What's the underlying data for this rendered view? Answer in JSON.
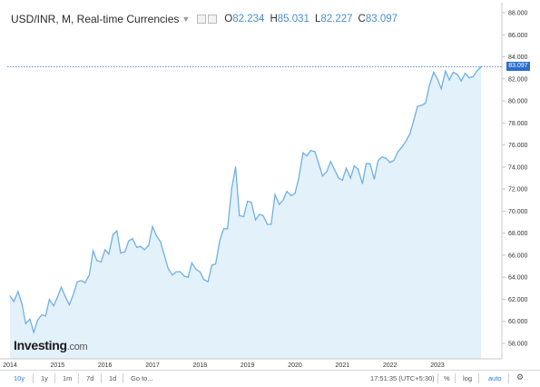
{
  "chart_data": {
    "type": "area",
    "title": "USD/INR, M, Real-time Currencies",
    "ohlc": {
      "open_label": "O",
      "open": "82.234",
      "high_label": "H",
      "high": "85.031",
      "low_label": "L",
      "low": "82.227",
      "close_label": "C",
      "close": "83.097"
    },
    "last_price_label": "83.097",
    "last_price": 83.097,
    "ylim": [
      57.0,
      88.5
    ],
    "xlim": [
      2014.0,
      2023.92
    ],
    "y_ticks": [
      "88.000",
      "86.000",
      "84.000",
      "82.000",
      "80.000",
      "78.000",
      "76.000",
      "74.000",
      "72.000",
      "70.000",
      "68.000",
      "66.000",
      "64.000",
      "62.000",
      "60.000",
      "58.000"
    ],
    "x_ticks": [
      "2014",
      "2015",
      "2016",
      "2017",
      "2018",
      "2019",
      "2020",
      "2021",
      "2022",
      "2023"
    ],
    "series": [
      {
        "color": "#6fb0e6",
        "fill": "#e3f1fb",
        "x": [
          2014.0,
          2014.08,
          2014.17,
          2014.25,
          2014.33,
          2014.42,
          2014.5,
          2014.58,
          2014.67,
          2014.75,
          2014.83,
          2014.92,
          2015.0,
          2015.08,
          2015.17,
          2015.25,
          2015.33,
          2015.42,
          2015.5,
          2015.58,
          2015.67,
          2015.75,
          2015.83,
          2015.92,
          2016.0,
          2016.08,
          2016.17,
          2016.25,
          2016.33,
          2016.42,
          2016.5,
          2016.58,
          2016.67,
          2016.75,
          2016.83,
          2016.92,
          2017.0,
          2017.08,
          2017.17,
          2017.25,
          2017.33,
          2017.42,
          2017.5,
          2017.58,
          2017.67,
          2017.75,
          2017.83,
          2017.92,
          2018.0,
          2018.08,
          2018.17,
          2018.25,
          2018.33,
          2018.42,
          2018.5,
          2018.58,
          2018.67,
          2018.75,
          2018.83,
          2018.92,
          2019.0,
          2019.08,
          2019.17,
          2019.25,
          2019.33,
          2019.42,
          2019.5,
          2019.58,
          2019.67,
          2019.75,
          2019.83,
          2019.92,
          2020.0,
          2020.08,
          2020.17,
          2020.25,
          2020.33,
          2020.42,
          2020.5,
          2020.58,
          2020.67,
          2020.75,
          2020.83,
          2020.92,
          2021.0,
          2021.08,
          2021.17,
          2021.25,
          2021.33,
          2021.42,
          2021.5,
          2021.58,
          2021.67,
          2021.75,
          2021.83,
          2021.92,
          2022.0,
          2022.08,
          2022.17,
          2022.25,
          2022.33,
          2022.42,
          2022.5,
          2022.58,
          2022.67,
          2022.75,
          2022.83,
          2022.92,
          2023.0,
          2023.08,
          2023.17,
          2023.25,
          2023.33,
          2023.42,
          2023.5,
          2023.58,
          2023.67,
          2023.75,
          2023.83,
          2023.92
        ],
        "values": [
          62.3,
          61.8,
          62.7,
          61.6,
          59.8,
          60.2,
          59.0,
          60.1,
          60.6,
          60.5,
          62.0,
          61.4,
          62.2,
          63.1,
          62.2,
          61.5,
          62.4,
          63.6,
          63.7,
          63.5,
          64.2,
          66.4,
          65.5,
          65.4,
          66.5,
          66.1,
          67.9,
          68.2,
          66.2,
          66.3,
          67.3,
          67.5,
          66.7,
          66.8,
          66.5,
          66.9,
          68.6,
          67.8,
          67.2,
          66.0,
          64.8,
          64.2,
          64.5,
          64.5,
          64.1,
          64.0,
          65.3,
          64.7,
          64.5,
          63.8,
          63.6,
          65.1,
          65.2,
          67.4,
          68.4,
          68.4,
          72.1,
          74.0,
          69.6,
          69.5,
          70.9,
          70.8,
          69.2,
          69.7,
          69.6,
          68.8,
          68.8,
          71.5,
          70.6,
          71.0,
          71.8,
          71.4,
          71.6,
          73.0,
          75.3,
          75.0,
          75.5,
          75.4,
          74.3,
          73.2,
          73.6,
          74.5,
          73.8,
          73.0,
          72.8,
          73.9,
          73.0,
          74.1,
          73.8,
          72.5,
          74.3,
          74.3,
          72.9,
          74.6,
          74.9,
          74.8,
          74.4,
          74.6,
          75.4,
          75.8,
          76.3,
          77.0,
          78.2,
          79.5,
          79.6,
          79.8,
          81.4,
          82.6,
          82.0,
          81.1,
          82.7,
          81.9,
          82.6,
          82.4,
          81.8,
          82.5,
          82.1,
          82.2,
          82.7,
          83.097
        ]
      }
    ],
    "grid": false,
    "legend": "top-left"
  },
  "logo": {
    "main": "Investing",
    "suffix": ".com"
  },
  "toolbar": {
    "r10y": "10y",
    "r1y": "1y",
    "r1m": "1m",
    "r7d": "7d",
    "r1d": "1d",
    "goto": "Go to...",
    "clock": "17:51:35 (UTC+5:30)",
    "pct": "%",
    "log": "log",
    "auto": "auto"
  }
}
